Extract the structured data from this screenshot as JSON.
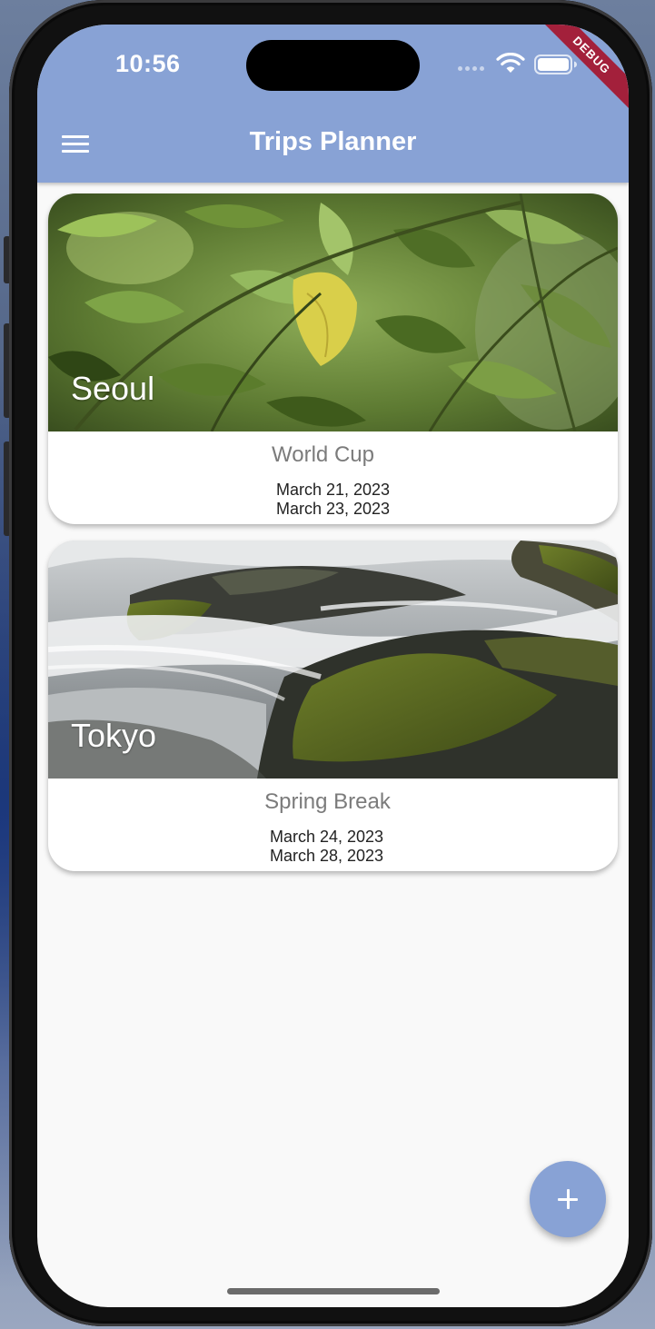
{
  "status_bar": {
    "time": "10:56"
  },
  "debug_banner": "DEBUG",
  "appbar": {
    "title": "Trips Planner",
    "color": "#88a2d5",
    "menu_icon": "hamburger-menu-icon"
  },
  "trips": [
    {
      "city": "Seoul",
      "name": "World Cup",
      "start_date": "March 21, 2023",
      "end_date": "March 23, 2023",
      "image": "green-leaves-photo"
    },
    {
      "city": "Tokyo",
      "name": "Spring Break",
      "start_date": "March 24, 2023",
      "end_date": "March 28, 2023",
      "image": "waterfall-rocks-photo"
    }
  ],
  "fab": {
    "icon": "plus-icon"
  }
}
